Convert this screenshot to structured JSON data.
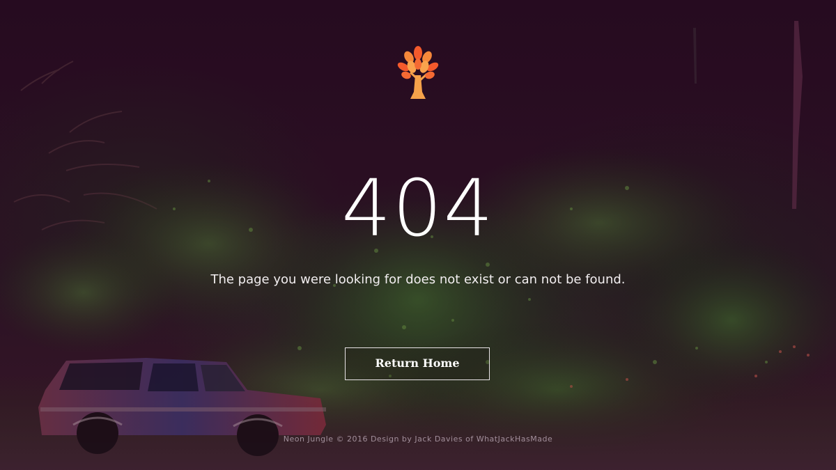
{
  "brand": {
    "logo_icon": "autumn-tree-icon",
    "logo_colors": [
      "#f45a2c",
      "#f78b3b",
      "#f6a24a"
    ]
  },
  "error": {
    "code": "404",
    "message": "The page you were looking for does not exist or can not be found."
  },
  "actions": {
    "return_home_label": "Return Home"
  },
  "footer": {
    "text": "Neon Jungle © 2016 Design by Jack Davies of WhatJackHasMade"
  },
  "background": {
    "scene": "dark jungle with abandoned truck"
  }
}
